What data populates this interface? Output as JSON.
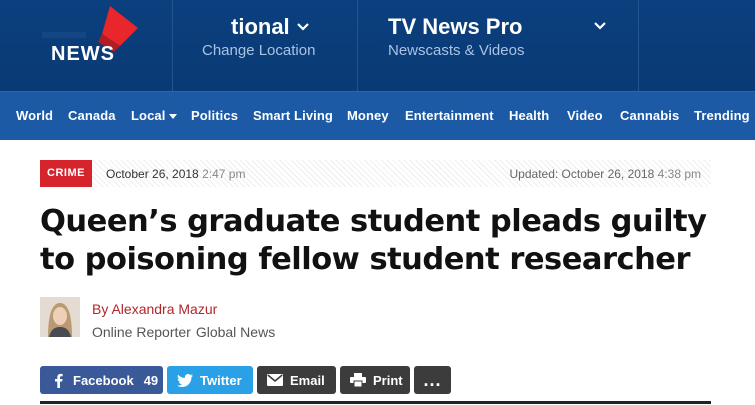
{
  "header": {
    "logo_text": "NEWS",
    "location": {
      "title": "tional",
      "subtitle": "Change Location"
    },
    "tv": {
      "title": "TV News Pro",
      "subtitle": "Newscasts & Videos"
    }
  },
  "nav": {
    "items": [
      {
        "label": "World"
      },
      {
        "label": "Canada"
      },
      {
        "label": "Local"
      },
      {
        "label": "Politics"
      },
      {
        "label": "Smart Living"
      },
      {
        "label": "Money"
      },
      {
        "label": "Entertainment"
      },
      {
        "label": "Health"
      },
      {
        "label": "Video"
      },
      {
        "label": "Cannabis"
      },
      {
        "label": "Trending"
      }
    ]
  },
  "article": {
    "category": "CRIME",
    "published_date": "October 26, 2018",
    "published_time": "2:47 pm",
    "updated_label": "Updated: October 26, 2018",
    "updated_time": "4:38 pm",
    "headline": "Queen’s graduate student pleads guilty to poisoning fellow student researcher",
    "author": {
      "byline": "By Alexandra Mazur",
      "role": "Online Reporter",
      "outlet": "Global News"
    }
  },
  "share": {
    "facebook_label": "Facebook",
    "facebook_count": "49",
    "twitter_label": "Twitter",
    "email_label": "Email",
    "print_label": "Print",
    "more_label": "..."
  },
  "colors": {
    "header_bg": "#0b3f7e",
    "nav_bg": "#1d5aa6",
    "accent_red": "#d6242c",
    "facebook": "#3a5998",
    "twitter": "#2aa1e6",
    "dark_button": "#3c3c3c"
  },
  "icons": [
    "logo-mark",
    "chevron-down-icon",
    "caret-down-icon",
    "facebook-icon",
    "twitter-icon",
    "email-icon",
    "print-icon"
  ]
}
